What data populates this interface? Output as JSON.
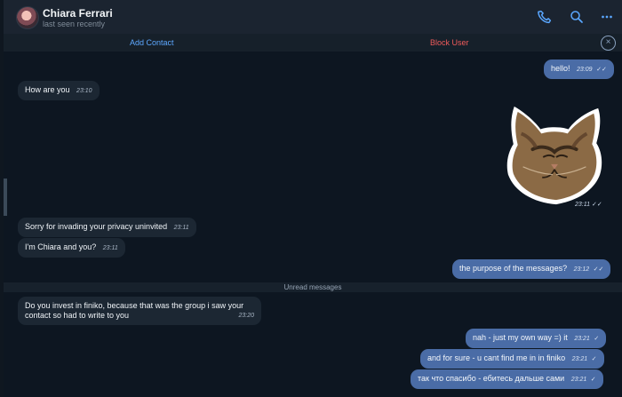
{
  "contact": {
    "name": "Chiara Ferrari",
    "status": "last seen recently"
  },
  "header": {
    "actions": [
      "phone",
      "search",
      "more"
    ]
  },
  "actionbar": {
    "add_contact": "Add Contact",
    "block_user": "Block User"
  },
  "messages": [
    {
      "text": "hello!",
      "time": "23:09",
      "sender": "out"
    },
    {
      "text": "How are you",
      "time": "23:10",
      "sender": "in"
    },
    {
      "text": "Sorry for invading your privacy uninvited",
      "time": "23:11",
      "sender": "in"
    },
    {
      "text": "I'm Chiara and you?",
      "time": "23:11",
      "sender": "in"
    },
    {
      "text": "the purpose of the messages?",
      "time": "23:12",
      "sender": "out"
    },
    {
      "text": "Do you invest in finiko, because that was the group i saw your contact so had to write to you",
      "time": "23:20",
      "sender": "in"
    },
    {
      "text": "nah - just my own way =) it",
      "time": "23:21",
      "sender": "out"
    },
    {
      "text": "and for sure - u cant find me in in finiko",
      "time": "23:21",
      "sender": "out"
    },
    {
      "text": "так что спасибо - ебитесь дальше сами",
      "time": "23:21",
      "sender": "out"
    }
  ],
  "divider": {
    "label": "Unread messages"
  },
  "sticker": {
    "time": "23:11"
  }
}
